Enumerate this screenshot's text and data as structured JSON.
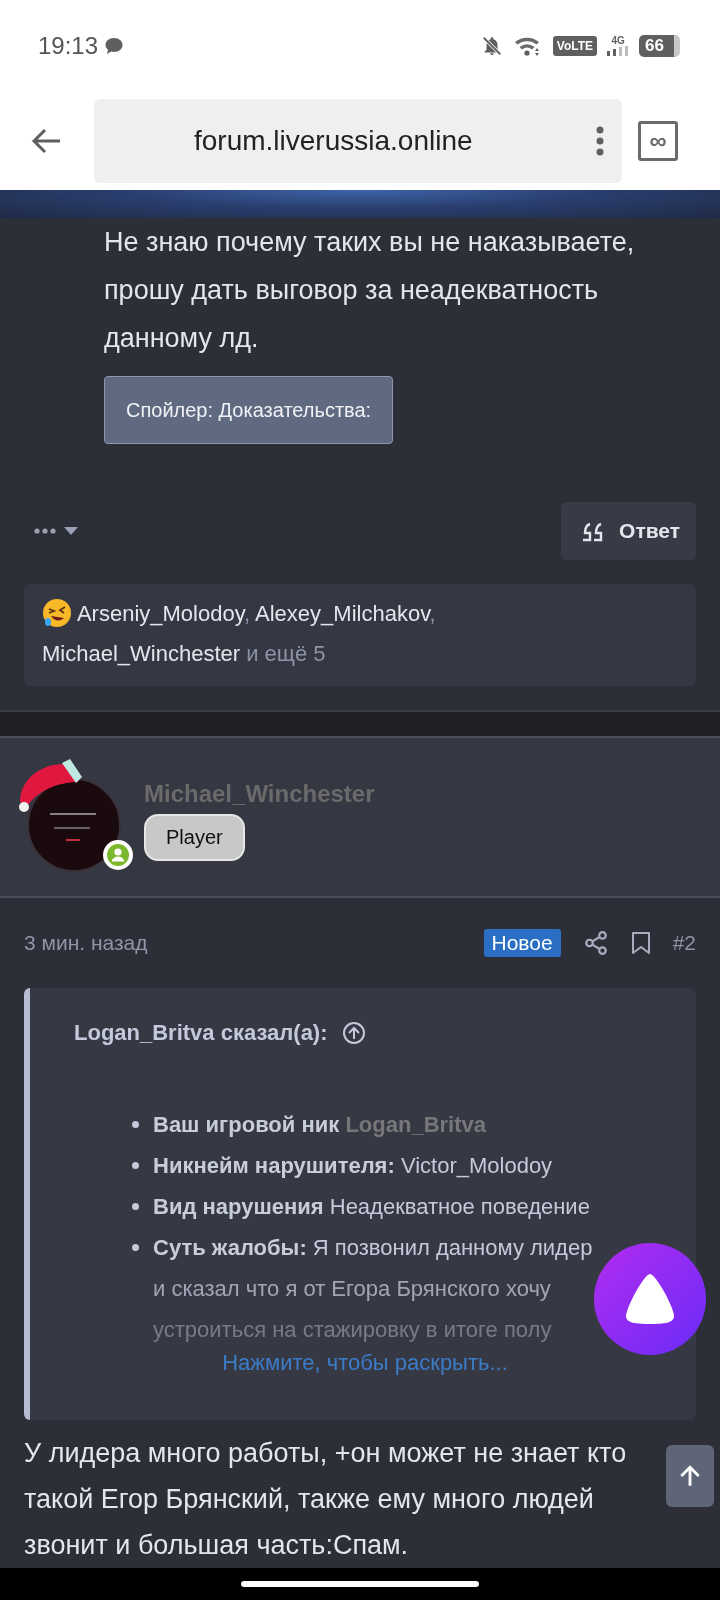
{
  "status_bar": {
    "time": "19:13",
    "volte": "VoLTE",
    "network": "4G",
    "battery": "66"
  },
  "browser": {
    "url": "forum.liverussia.online",
    "tab_label": "∞"
  },
  "post_1": {
    "text": "Не знаю почему таких вы не наказываете, прошу дать выговор за неадекватность данному лд.",
    "spoiler": "Спойлер: Доказательства:",
    "reply_button": "Ответ",
    "reactions": {
      "users": [
        {
          "name": "Arseniy_Molodoy",
          "sep": ","
        },
        {
          "name": "Alexey_Milchakov",
          "sep": ","
        },
        {
          "name": "Michael_Winchester"
        }
      ],
      "more": "и ещё 5"
    }
  },
  "post_2": {
    "author": {
      "name": "Michael_Winchester",
      "badge": "Player",
      "online": true
    },
    "time": "3 мин. назад",
    "new_badge": "Новое",
    "number": "#2",
    "quote": {
      "title": "Logan_Britva сказал(а):",
      "items": [
        {
          "text": "**Ваш игровой ник**",
          "link": "Logan_Britva"
        },
        {
          "text": "**Никнейм нарушителя:** Victor_Molodoy"
        },
        {
          "text": "**Вид нарушения** Неадекватное поведение"
        },
        {
          "text": "**Суть жалобы:** Я позвонил данному лидер",
          "continuation": [
            "и сказал что я от Егора Брянского хочу",
            "устроиться на стажировку в итоге полу"
          ]
        }
      ],
      "expand": "Нажмите, чтобы раскрыть..."
    },
    "text": "У лидера много работы, +он может не знает кто такой Егор Брянский, также ему много людей звонит и большая часть:Спам."
  }
}
